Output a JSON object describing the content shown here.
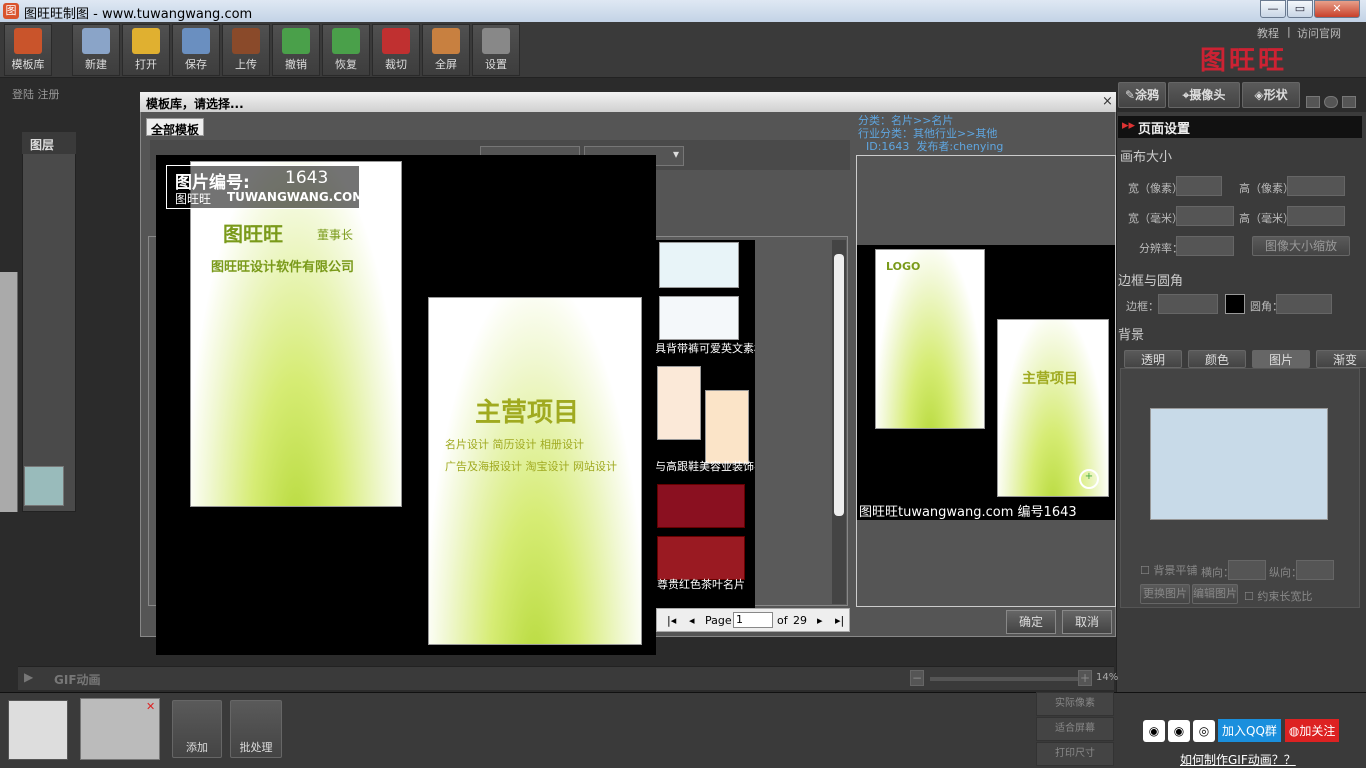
{
  "window": {
    "title": "图旺旺制图 - www.tuwangwang.com",
    "icon": "app-logo-icon",
    "minimize": "—",
    "maximize": "▭",
    "close": "✕"
  },
  "toolbar": {
    "items": [
      {
        "name": "template-library",
        "label": "模板库",
        "icon": "house-icon",
        "color": "#c9542b"
      },
      {
        "name": "new",
        "label": "新建",
        "icon": "new-file-icon",
        "color": "#8aa4c8"
      },
      {
        "name": "open",
        "label": "打开",
        "icon": "folder-icon",
        "color": "#e0b030"
      },
      {
        "name": "save",
        "label": "保存",
        "icon": "floppy-icon",
        "color": "#6a8fc0"
      },
      {
        "name": "upload",
        "label": "上传",
        "icon": "book-upload-icon",
        "color": "#8a4a2a"
      },
      {
        "name": "undo",
        "label": "撤销",
        "icon": "undo-arrow-icon",
        "color": "#4aa04a"
      },
      {
        "name": "redo",
        "label": "恢复",
        "icon": "redo-arrow-icon",
        "color": "#4aa04a"
      },
      {
        "name": "crop",
        "label": "裁切",
        "icon": "scissors-icon",
        "color": "#c03030"
      },
      {
        "name": "fullscreen",
        "label": "全屏",
        "icon": "fullscreen-icon",
        "color": "#c88040"
      },
      {
        "name": "settings",
        "label": "设置",
        "icon": "gear-icon",
        "color": "#888888"
      }
    ]
  },
  "links": {
    "tutorial": "教程",
    "official": "访问官网",
    "sep": "|"
  },
  "brand": "图旺旺",
  "auth": {
    "login": "登陆",
    "register": "注册"
  },
  "righttools": {
    "paint": "涂鸦",
    "camera": "摄像头",
    "shape": "形状"
  },
  "layers": {
    "title": "图层"
  },
  "modal": {
    "title": "模板库，请选择...",
    "tab": "全部模板",
    "close": "×",
    "info": {
      "category": "分类：名片>>名片",
      "industry": "行业分类：其他行业>>其他",
      "id": "ID:1643",
      "publisher": "发布者:chenying"
    },
    "pager": {
      "page_label": "Page",
      "page": "1",
      "of": "of",
      "total": "29"
    },
    "ok": "确定",
    "cancel": "取消",
    "thumbs": [
      {
        "caption": "具背带裤可爱英文素材"
      },
      {
        "caption": "与高跟鞋美容业装饰名"
      },
      {
        "caption": "尊贵红色茶叶名片"
      }
    ]
  },
  "overlay": {
    "stamp_title": "图片编号:",
    "stamp_id": "1643",
    "stamp_brand": "图旺旺",
    "stamp_url": "TUWANGWANG.COM",
    "front": {
      "brand": "图旺旺",
      "role": "董事长",
      "company": "图旺旺设计软件有限公司"
    },
    "back": {
      "heading": "主营项目",
      "line1": "名片设计   简历设计   相册设计",
      "line2": "广告及海报设计 淘宝设计 网站设计"
    },
    "preview_logo": "LOGO",
    "watermark": "图旺旺tuwangwang.com 编号1643"
  },
  "page_settings": {
    "title": "页面设置",
    "canvas_size": "画布大小",
    "width_px": "宽（像素）",
    "height_px": "高（像素）",
    "width_mm": "宽（毫米）",
    "height_mm": "高（毫米）",
    "resolution": "分辨率：",
    "resize": "图像大小缩放",
    "border_section": "边框与圆角",
    "border": "边框：",
    "radius": "圆角：",
    "background": "背景",
    "bg_tabs": [
      "透明",
      "颜色",
      "图片",
      "渐变"
    ],
    "tile": "背景平铺",
    "horiz": "横向：",
    "vert": "纵向：",
    "change_image": "更换图片",
    "edit_image": "编辑图片",
    "lock_ratio": "约束长宽比"
  },
  "gif": {
    "label": "GIF动画",
    "zoom": "14%"
  },
  "bottom": {
    "add": "添加",
    "batch": "批处理",
    "actual": "实际像素",
    "fit": "适合屏幕",
    "print": "打印尺寸"
  },
  "social": {
    "join": "加入QQ群",
    "follow": "加关注",
    "howto": "如何制作GIF动画？？"
  }
}
